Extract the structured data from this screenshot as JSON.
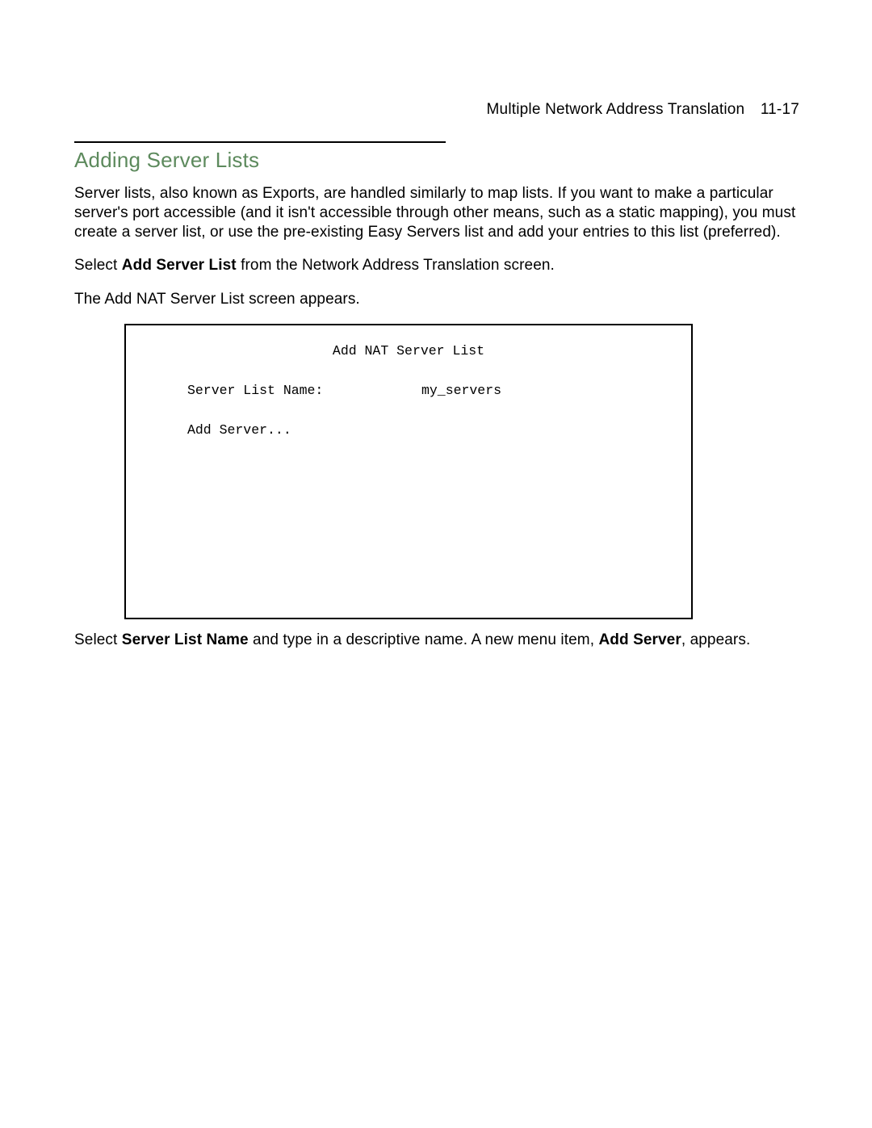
{
  "header": {
    "chapter_title": "Multiple Network Address Translation",
    "page_number": "11-17"
  },
  "section": {
    "heading": "Adding Server Lists",
    "paragraph1": "Server lists, also known as Exports, are handled similarly to map lists. If you want to make a particular server's port accessible (and it isn't accessible through other means, such as a static mapping), you must create a server list, or use the pre-existing Easy Servers list and add your entries to this list (preferred).",
    "paragraph2_pre": "Select ",
    "paragraph2_bold": "Add Server List",
    "paragraph2_post": " from the Network Address Translation screen.",
    "paragraph3": "The Add NAT Server List screen appears."
  },
  "terminal": {
    "title": "Add NAT Server List",
    "field_label": "Server List Name:",
    "field_value": "my_servers",
    "add_server": "Add Server..."
  },
  "footer": {
    "pre": "Select ",
    "bold1": "Server List Name",
    "mid": " and type in a descriptive name. A new menu item, ",
    "bold2": "Add Server",
    "post": ", appears."
  }
}
